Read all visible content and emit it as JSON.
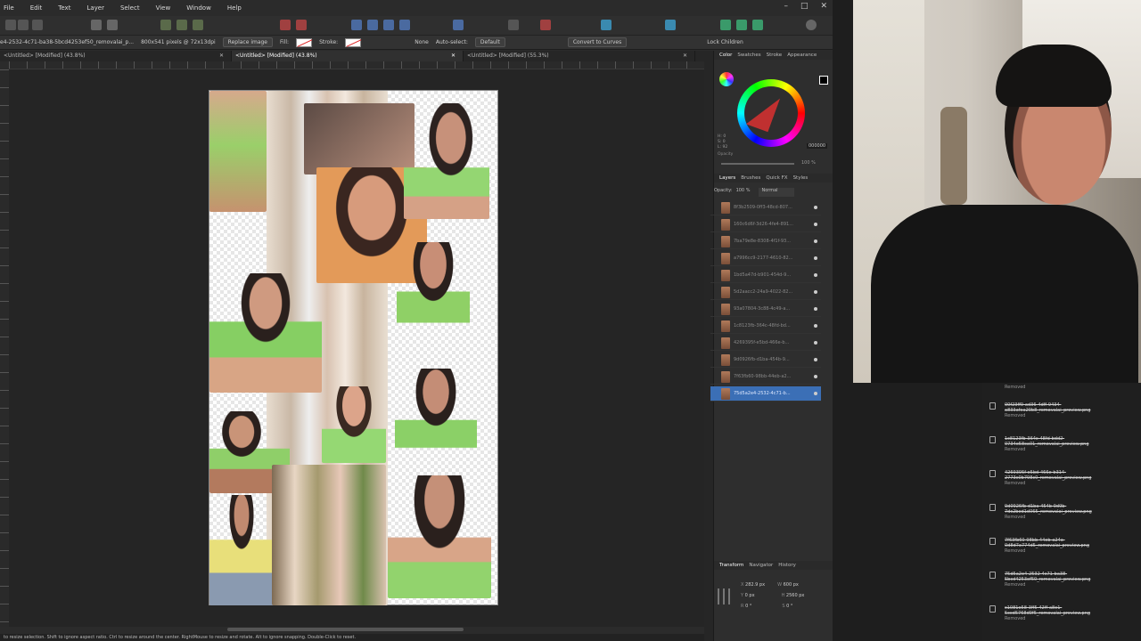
{
  "menu": [
    "File",
    "Edit",
    "Text",
    "Layer",
    "Select",
    "View",
    "Window",
    "Help"
  ],
  "window_controls": [
    "–",
    "□",
    "✕"
  ],
  "context_bar": {
    "layer_name": "e4-2532-4c71-ba38-5bcd4253ef50_removalai_p...",
    "pixels": "800x541 pixels @ 72x13dpi",
    "replace_image": "Replace image",
    "fill_label": "Fill:",
    "stroke_label": "Stroke:",
    "none": "None",
    "auto_select": "Auto-select:",
    "auto_select_value": "Default",
    "convert": "Convert to Curves",
    "lock_children": "Lock Children"
  },
  "tabs": [
    {
      "label": "<Untitled> [Modified] (43.8%)",
      "close": "✕"
    },
    {
      "label": "<Untitled> [Modified] (43.8%)",
      "close": "✕"
    },
    {
      "label": "<Untitled> [Modified] (55.3%)",
      "close": "✕"
    }
  ],
  "color_panel": {
    "tabs": [
      "Color",
      "Swatches",
      "Stroke",
      "Appearance"
    ],
    "hsl": [
      "H: 0",
      "S: 0",
      "L: 92"
    ],
    "hex": "000000",
    "opacity_label": "Opacity",
    "opacity_value": "100 %"
  },
  "layers_panel": {
    "tabs": [
      "Layers",
      "Brushes",
      "Quick FX",
      "Styles"
    ],
    "opacity_label": "Opacity:",
    "opacity_value": "100 %",
    "blend": "Normal",
    "layers": [
      "8f3b2509-0ff3-48cd-807...",
      "160c6d6f-3d26-4fe4-891...",
      "7ba79e8e-8308-4f1f-93...",
      "a7996cc9-2177-4610-82...",
      "1bd5a47d-b901-454d-9...",
      "5d2aacc2-24a9-4022-82...",
      "93a07804-3c88-4c49-a...",
      "1c8123fb-364c-48fd-bd...",
      "4269395f-e5bd-466e-b...",
      "9d0926fb-d1ba-454b-9...",
      "7f63fb60-98bb-44eb-a2...",
      "75d5a2e4-2532-4c71-b..."
    ],
    "selected_index": 11
  },
  "transform_panel": {
    "tabs": [
      "Transform",
      "Navigator",
      "History"
    ],
    "x": "282.9 px",
    "y": "0 px",
    "w": "600 px",
    "h": "2560 px",
    "r": "0 °",
    "s": "0 °"
  },
  "statusbar": "to resize selection. Shift to ignore aspect ratio. Ctrl to resize around the center. RightMouse to resize and rotate. Alt to ignore snapping. Double-Click to reset.",
  "downloads": [
    {
      "name": "",
      "status": "Removed"
    },
    {
      "name": "00f23ff9-ad36-4dff-9434-a833afea29b8_removalai_preview.png",
      "status": "Removed"
    },
    {
      "name": "1c8123fb-364c-48fd-bdd2-0734e58ca01_removalai_preview.png",
      "status": "Removed"
    },
    {
      "name": "4269395f-e5bd-466e-b314-2773c0b798c0_removalai_preview.png",
      "status": "Removed"
    },
    {
      "name": "9d0926fb-d1ba-454b-9d9b-7dc2bed1d065_removalai_preview.png",
      "status": "Removed"
    },
    {
      "name": "7f63fb60-98bb-44eb-a24a-0d8d7a774d5_removalai_preview.png",
      "status": "Removed"
    },
    {
      "name": "75d5a2e4-2532-4c71-ba38-5bcd4253ef50_removalai_preview.png",
      "status": "Removed"
    },
    {
      "name": "c1081e58-3ff5-42ff-a8e1-5ccd5768d9f5_removalai_preview.png",
      "status": "Removed"
    }
  ],
  "colors": {
    "accent": "#3b6fb6",
    "app_bg": "#2b2b2b",
    "panel_bg": "#2e2e2e"
  }
}
